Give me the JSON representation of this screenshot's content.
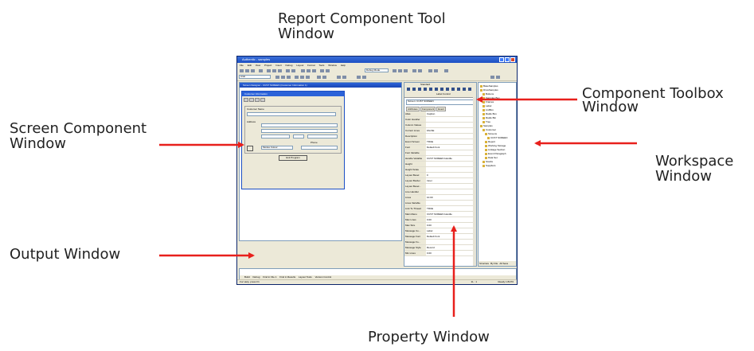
{
  "callouts": {
    "tool_window": {
      "line1": "Report Component Tool",
      "line2": "Window"
    },
    "toolbox_window": {
      "line1": "Component Toolbox",
      "line2": "Window"
    },
    "screen_component": {
      "line1": "Screen Component",
      "line2": "Window"
    },
    "workspace": {
      "line1": "Workspace",
      "line2": "Window"
    },
    "output": {
      "line1": "Output Window"
    },
    "property": {
      "line1": "Property Window"
    }
  },
  "colors": {
    "arrow": "#e8201c",
    "titlebar": "#1c4fc4"
  },
  "app": {
    "title": "Authentic - samples",
    "menu": [
      "File",
      "Edit",
      "View",
      "Project",
      "Insert",
      "Debug",
      "Layout",
      "Format",
      "Tools",
      "Window",
      "Help"
    ],
    "combo1": "Debug Mode",
    "combo2": "Arial",
    "designer_title": "Screen Designer - CUST SCREEN (Customer Information 1)",
    "form": {
      "title": "Customer Information",
      "customer_name": "Customer Name",
      "address": "Address",
      "phone": "Phone",
      "combo": "Modes Colour",
      "button": "Exit Program"
    },
    "toolbox": {
      "title": "Standard",
      "selected": "Label Control"
    },
    "properties": {
      "object": "Screen: CUST SCREEN",
      "tabs": [
        "Attributes",
        "Component",
        "Event"
      ],
      "rows": [
        {
          "name": "Alias",
          "value": "Caption"
        },
        {
          "name": "Color Handler",
          "value": ""
        },
        {
          "name": "Column Values",
          "value": ""
        },
        {
          "name": "Current Lines",
          "value": "FALSE"
        },
        {
          "name": "Description",
          "value": ""
        },
        {
          "name": "Event Screen",
          "value": "TRUE"
        },
        {
          "name": "Font",
          "value": "Default Font"
        },
        {
          "name": "Font Variable",
          "value": ""
        },
        {
          "name": "Handle Variable",
          "value": "CUST SCREEN Handle"
        },
        {
          "name": "Height",
          "value": ""
        },
        {
          "name": "Height Scale",
          "value": ""
        },
        {
          "name": "Layout Bevel",
          "value": "0"
        },
        {
          "name": "Layout Border",
          "value": "Inner"
        },
        {
          "name": "Layout Bevel...",
          "value": ""
        },
        {
          "name": "Line Handler",
          "value": ""
        },
        {
          "name": "Lines",
          "value": "10.00"
        },
        {
          "name": "Lines Variable",
          "value": ""
        },
        {
          "name": "Link To Thread",
          "value": "TRUE"
        },
        {
          "name": "Main Menu",
          "value": "CUST SCREEN Handle"
        },
        {
          "name": "Max Lines",
          "value": "0.00"
        },
        {
          "name": "Max Size",
          "value": "0.00"
        },
        {
          "name": "Message Co...",
          "value": "Label"
        },
        {
          "name": "Message Font",
          "value": "Default Font"
        },
        {
          "name": "Message Fo...",
          "value": ""
        },
        {
          "name": "Message Style",
          "value": "Record"
        },
        {
          "name": "Min Lines",
          "value": "0.00"
        }
      ]
    },
    "workspace": {
      "items": [
        "BaseSamples",
        "DriveSamples",
        "Buttons",
        "Samples Box",
        "Frames",
        "Label",
        "ListBox",
        "Radio Box",
        "Radio Btn",
        "Tree",
        "Samples",
        "Customer",
        "Screens",
        "CUST SCREEN",
        "Report",
        "Working Storage",
        "Linkage Section",
        "Event Paragraph",
        "Data Set",
        "Stocks",
        "Suppliers"
      ],
      "tabs": [
        "Structure",
        "By File",
        "All Sess"
      ]
    },
    "output_tabs": [
      "Build",
      "Debug",
      "Find in File 1",
      "Find in Results",
      "Layout Tools",
      "Version Control"
    ],
    "status": {
      "left": "For Help, press F1",
      "mid": "2L : 1",
      "right": "Ready 1:8/270"
    }
  }
}
